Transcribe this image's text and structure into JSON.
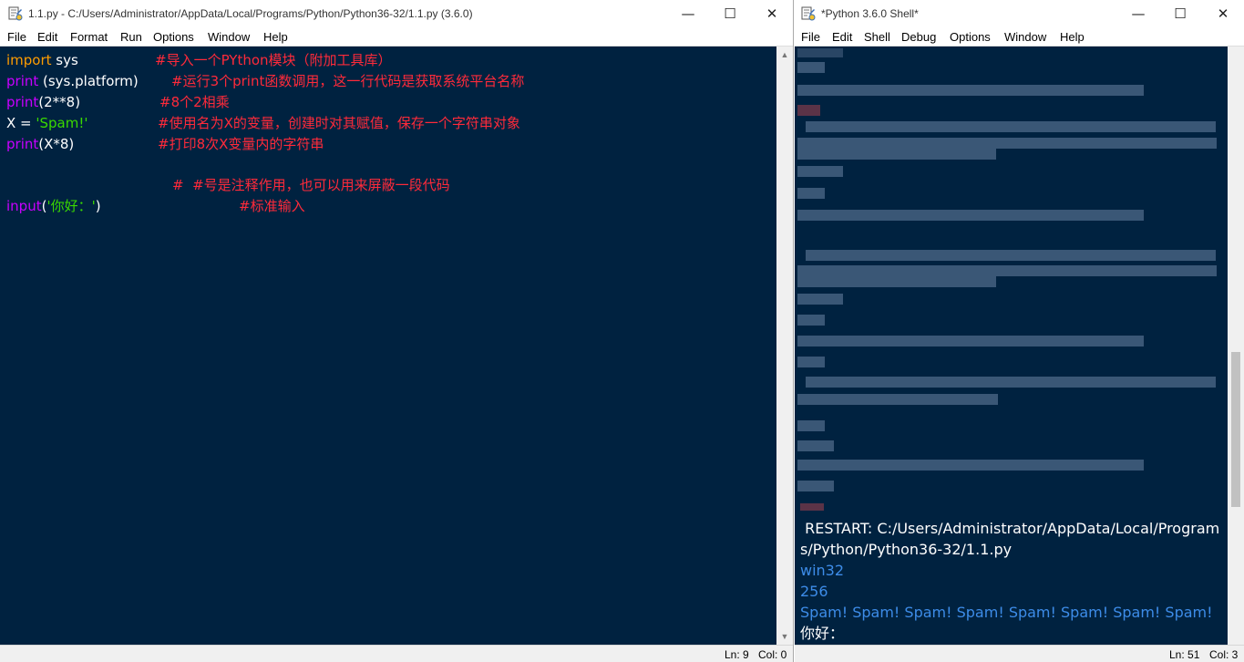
{
  "editor": {
    "title": "1.1.py - C:/Users/Administrator/AppData/Local/Programs/Python/Python36-32/1.1.py (3.6.0)",
    "menu": [
      "File",
      "Edit",
      "Format",
      "Run",
      "Options",
      "Window",
      "Help"
    ],
    "lines": [
      {
        "kw": "import",
        "code": " sys",
        "comment": "#导入一个PYthon模块（附加工具库）"
      },
      {
        "kw": "print",
        "code": " (sys.platform)",
        "comment": "#运行3个print函数调用，这一行代码是获取系统平台名称"
      },
      {
        "kw": "print",
        "code": "(2**8)",
        "comment": "#8个2相乘"
      },
      {
        "pre": "X = ",
        "str": "'Spam!'",
        "comment": "#使用名为X的变量，创建时对其赋值，保存一个字符串对象"
      },
      {
        "kw": "print",
        "code": "(X*8)",
        "comment": "#打印8次X变量内的字符串"
      },
      {
        "comment": "#  #号是注释作用，也可以用来屏蔽一段代码"
      },
      {
        "kw": "input",
        "code_open": "(",
        "str": "'你好：'",
        "code_close": ")",
        "comment": "#标准输入"
      }
    ],
    "status": {
      "ln": "Ln: 9",
      "col": "Col: 0"
    }
  },
  "shell": {
    "title": "*Python 3.6.0 Shell*",
    "menu": [
      "File",
      "Edit",
      "Shell",
      "Debug",
      "Options",
      "Window",
      "Help"
    ],
    "restart_line1": " RESTART: C:/Users/Administrator/AppData/Local/Program",
    "restart_line2": "s/Python/Python36-32/1.1.py",
    "outputs": [
      "win32",
      "256",
      "Spam! Spam! Spam! Spam! Spam! Spam! Spam! Spam!",
      "你好："
    ],
    "status": {
      "ln": "Ln: 51",
      "col": "Col: 3"
    }
  },
  "controls": {
    "minimize": "—",
    "maximize": "☐",
    "close": "✕"
  },
  "colors": {
    "background": "#002240",
    "keyword": "#ff9d00",
    "builtin": "#c800ff",
    "string": "#3ad900",
    "comment": "#ff2a3a",
    "shell_output": "#3d8ce8"
  }
}
